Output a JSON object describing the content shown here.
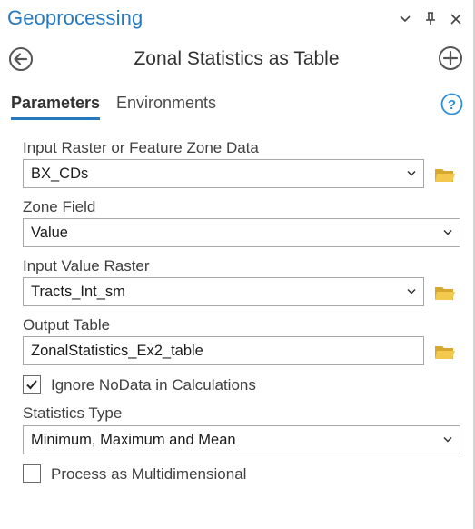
{
  "pane": {
    "title": "Geoprocessing",
    "options_icon": "chevron-down-icon",
    "pin_icon": "pin-icon",
    "close_icon": "close-icon"
  },
  "tool": {
    "title": "Zonal Statistics as Table",
    "back_icon": "back-arrow-circle-icon",
    "add_icon": "add-circle-icon"
  },
  "tabs": {
    "parameters": "Parameters",
    "environments": "Environments",
    "help_icon": "help-circle-icon",
    "active": "Parameters"
  },
  "params": {
    "zone_data": {
      "label": "Input Raster or Feature Zone Data",
      "value": "BX_CDs"
    },
    "zone_field": {
      "label": "Zone Field",
      "value": "Value"
    },
    "value_raster": {
      "label": "Input Value Raster",
      "value": "Tracts_Int_sm"
    },
    "output_table": {
      "label": "Output Table",
      "value": "ZonalStatistics_Ex2_table"
    },
    "ignore_nodata": {
      "label": "Ignore NoData in Calculations",
      "checked": true
    },
    "statistics_type": {
      "label": "Statistics Type",
      "value": "Minimum, Maximum and Mean"
    },
    "multidimensional": {
      "label": "Process as Multidimensional",
      "checked": false
    }
  },
  "colors": {
    "accent": "#2679c0",
    "folder": "#e8b93a",
    "help": "#2e8ede"
  }
}
